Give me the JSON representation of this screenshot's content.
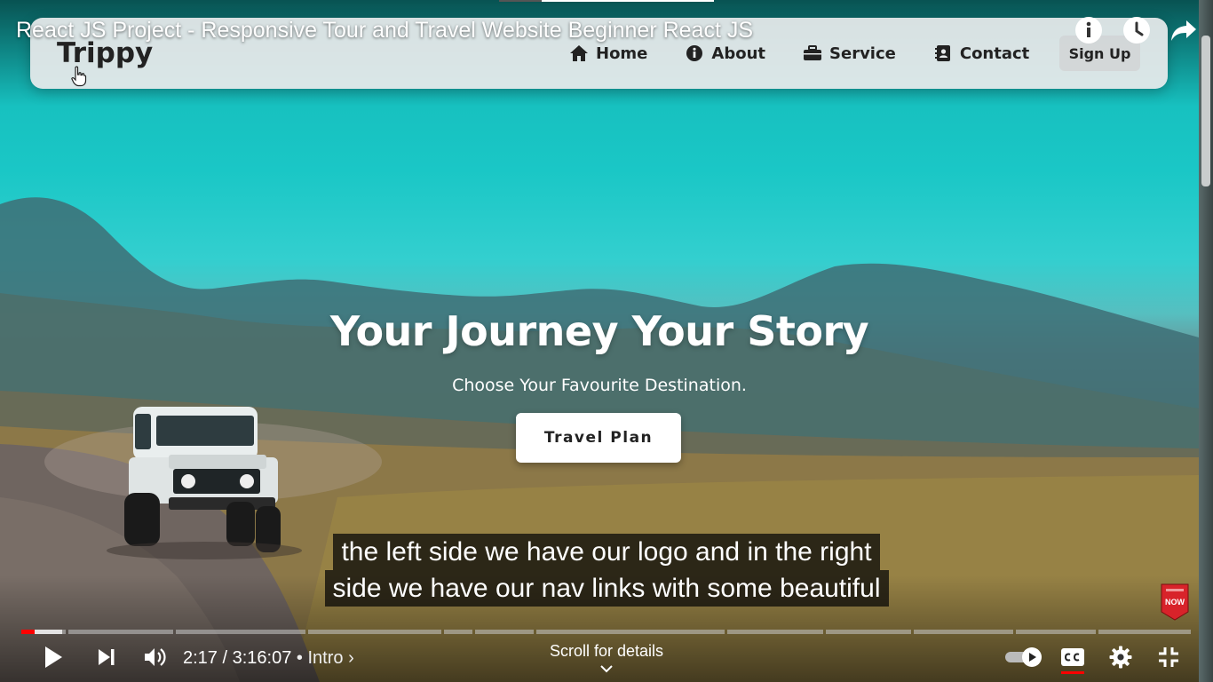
{
  "video": {
    "title": "React JS Project - Responsive Tour and Travel Website Beginner React JS"
  },
  "website": {
    "logo": "Trippy",
    "nav": [
      {
        "label": "Home",
        "icon": "house-icon"
      },
      {
        "label": "About",
        "icon": "info-circle-icon"
      },
      {
        "label": "Service",
        "icon": "briefcase-icon"
      },
      {
        "label": "Contact",
        "icon": "address-book-icon"
      }
    ],
    "signup_label": "Sign Up",
    "hero": {
      "title": "Your Journey Your Story",
      "subtitle": "Choose Your Favourite Destination.",
      "button_label": "Travel Plan"
    }
  },
  "captions": {
    "line1": "the left side we have our logo and in the right",
    "line2": "side we have our nav links with some beautiful"
  },
  "subscribe_badge": {
    "text": "NOW",
    "color": "#d8232a"
  },
  "player": {
    "current_time": "2:17",
    "duration": "3:16:07",
    "separator": " / ",
    "chapter": "Intro",
    "scroll_hint": "Scroll for details",
    "progress_fraction": 0.0117,
    "accent_color": "#ff0000"
  },
  "top_icons": [
    "info-icon",
    "watch-later-clock-icon",
    "share-arrow-icon"
  ],
  "control_icons": [
    "play-icon",
    "next-icon",
    "volume-icon",
    "autoplay-toggle-icon",
    "captions-icon",
    "settings-gear-icon",
    "exit-fullscreen-icon"
  ]
}
